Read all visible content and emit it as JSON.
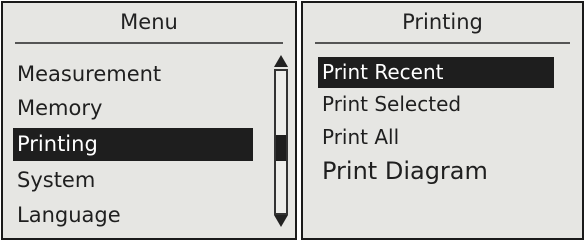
{
  "left_panel": {
    "title": "Menu",
    "items": [
      {
        "label": "Measurement",
        "selected": false
      },
      {
        "label": "Memory",
        "selected": false
      },
      {
        "label": "Printing",
        "selected": true
      },
      {
        "label": "System",
        "selected": false
      },
      {
        "label": "Language",
        "selected": false
      }
    ],
    "scrollbar": {
      "up_icon": "triangle-up-icon",
      "down_icon": "triangle-down-icon",
      "position_fraction": 0.55
    }
  },
  "right_panel": {
    "title": "Printing",
    "items": [
      {
        "label": "Print Recent",
        "selected": true
      },
      {
        "label": "Print Selected",
        "selected": false
      },
      {
        "label": "Print All",
        "selected": false
      },
      {
        "label": "Print Diagram",
        "selected": false
      }
    ]
  },
  "colors": {
    "screen_background": "#e6e6e3",
    "selection_background": "#1e1e1e",
    "selection_text": "#ffffff",
    "text": "#1f1f1f"
  }
}
